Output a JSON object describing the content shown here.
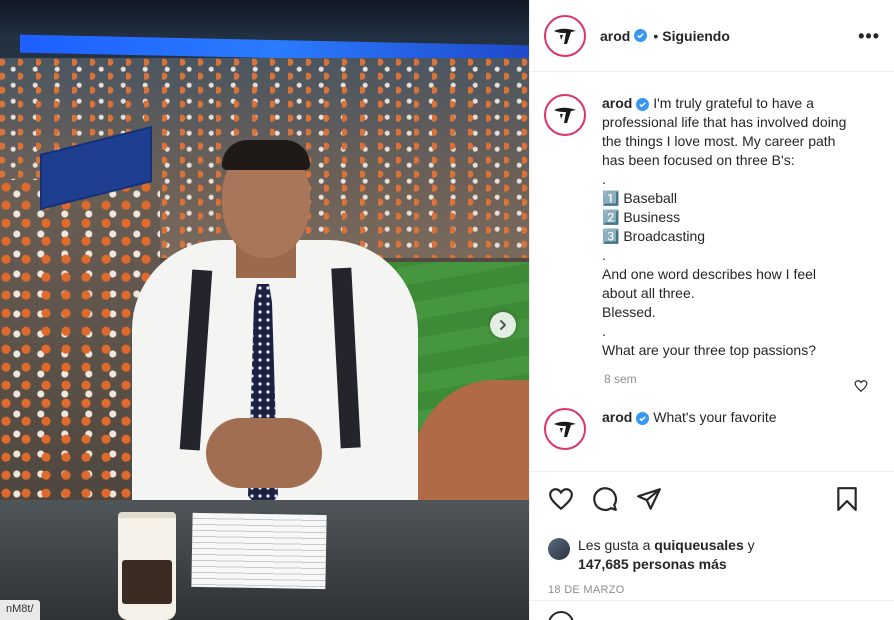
{
  "photo": {
    "url_tag": "nM8t/"
  },
  "header": {
    "username": "arod",
    "separator": "•",
    "follow_status": "Siguiendo",
    "more": "•••"
  },
  "caption": {
    "username": "arod",
    "text": "I'm truly grateful to have a professional life that has involved doing the things I love most. My career path has been focused on three B's:\n.\n1️⃣ Baseball\n2️⃣ Business\n3️⃣ Broadcasting\n.\nAnd one word describes how I feel about all three.\nBlessed.\n.\nWhat are your three top passions?",
    "time": "8 sem"
  },
  "comment": {
    "username": "arod",
    "text": "What's your favorite"
  },
  "likes": {
    "prefix": "Les gusta a",
    "user": "quiqueusales",
    "connector": "y",
    "count": "147,685 personas más"
  },
  "date": "18 DE MARZO",
  "colors": {
    "verified": "#3897f0",
    "ring": "#d9346e"
  }
}
